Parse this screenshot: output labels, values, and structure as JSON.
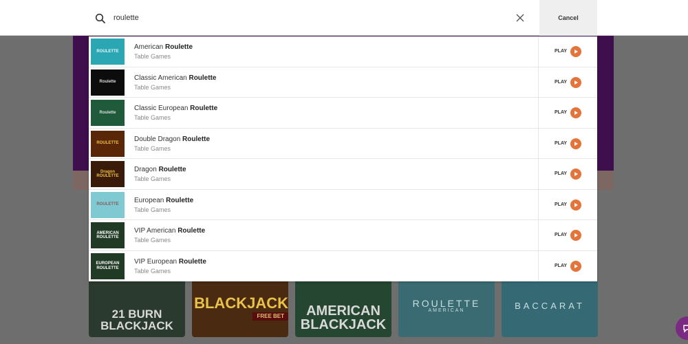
{
  "search": {
    "value": "roulette",
    "cancel_label": "Cancel"
  },
  "results": [
    {
      "title_prefix": "American ",
      "title_match": "Roulette",
      "category": "Table Games",
      "play_label": "PLAY",
      "thumb_text": "ROULETTE",
      "thumb_bg": "#2aa7b3",
      "thumb_color": "#e8f7f8"
    },
    {
      "title_prefix": "Classic American ",
      "title_match": "Roulette",
      "category": "Table Games",
      "play_label": "PLAY",
      "thumb_text": "Roulette",
      "thumb_bg": "#0c0c0c",
      "thumb_color": "#dddddd"
    },
    {
      "title_prefix": "Classic European ",
      "title_match": "Roulette",
      "category": "Table Games",
      "play_label": "PLAY",
      "thumb_text": "Roulette",
      "thumb_bg": "#1f5a3b",
      "thumb_color": "#dddddd"
    },
    {
      "title_prefix": "Double Dragon ",
      "title_match": "Roulette",
      "category": "Table Games",
      "play_label": "PLAY",
      "thumb_text": "ROULETTE",
      "thumb_bg": "#5a2608",
      "thumb_color": "#f0c040"
    },
    {
      "title_prefix": "Dragon ",
      "title_match": "Roulette",
      "category": "Table Games",
      "play_label": "PLAY",
      "thumb_text": "Dragon ROULETTE",
      "thumb_bg": "#3a1a08",
      "thumb_color": "#f0c040"
    },
    {
      "title_prefix": "European ",
      "title_match": "Roulette",
      "category": "Table Games",
      "play_label": "PLAY",
      "thumb_text": "ROULETTE",
      "thumb_bg": "#7fc9d2",
      "thumb_color": "#8a5a5a"
    },
    {
      "title_prefix": "VIP American ",
      "title_match": "Roulette",
      "category": "Table Games",
      "play_label": "PLAY",
      "thumb_text": "AMERICAN ROULETTE",
      "thumb_bg": "#213a26",
      "thumb_color": "#ffffff"
    },
    {
      "title_prefix": "VIP European ",
      "title_match": "Roulette",
      "category": "Table Games",
      "play_label": "PLAY",
      "thumb_text": "EUROPEAN ROULETTE",
      "thumb_bg": "#213a26",
      "thumb_color": "#ffffff"
    }
  ],
  "background_tiles": {
    "tile1": "21 BURN BLACKJACK",
    "tile2_big": "BLACKJACK",
    "tile2_small": "FREE BET",
    "tile3": "AMERICAN BLACKJACK",
    "tile4_big": "ROULETTE",
    "tile4_small": "AMERICAN",
    "tile5": "BACCARAT"
  },
  "colors": {
    "accent": "#e4743a",
    "overlay": "#6e6e6e",
    "banner": "#3f0f4d"
  },
  "icons": {
    "search": "search-icon",
    "clear": "close-icon",
    "play": "play-icon",
    "chat": "chat-icon"
  }
}
